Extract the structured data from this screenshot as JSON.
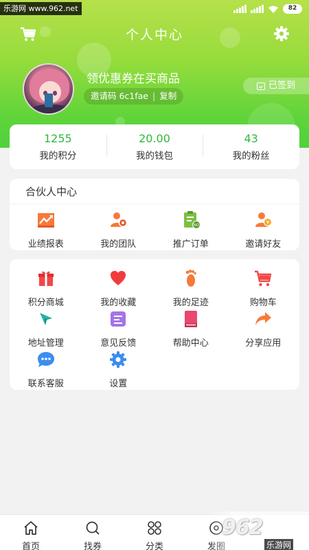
{
  "status_bar": {
    "watermark": "乐游网 www.962.net",
    "battery": "82"
  },
  "header": {
    "title": "个人中心"
  },
  "profile": {
    "username": "领优惠券在买商品",
    "invite_label": "邀请码 6c1fae",
    "copy_label": "复制",
    "signin_label": "已签到"
  },
  "stats": [
    {
      "value": "1255",
      "label": "我的积分"
    },
    {
      "value": "20.00",
      "label": "我的钱包"
    },
    {
      "value": "43",
      "label": "我的粉丝"
    }
  ],
  "partner": {
    "title": "合伙人中心",
    "items": [
      {
        "label": "业绩报表",
        "icon": "chart-trend-icon"
      },
      {
        "label": "我的团队",
        "icon": "team-icon"
      },
      {
        "label": "推广订单",
        "icon": "order-clipboard-icon"
      },
      {
        "label": "邀请好友",
        "icon": "invite-friend-icon"
      }
    ]
  },
  "tools": {
    "items": [
      {
        "label": "积分商城",
        "icon": "gift-icon"
      },
      {
        "label": "我的收藏",
        "icon": "heart-icon"
      },
      {
        "label": "我的足迹",
        "icon": "footprint-icon"
      },
      {
        "label": "购物车",
        "icon": "shopping-cart-icon"
      },
      {
        "label": "地址管理",
        "icon": "location-compass-icon"
      },
      {
        "label": "意见反馈",
        "icon": "feedback-icon"
      },
      {
        "label": "帮助中心",
        "icon": "help-book-icon"
      },
      {
        "label": "分享应用",
        "icon": "share-arrow-icon"
      },
      {
        "label": "联系客服",
        "icon": "chat-bubble-icon"
      },
      {
        "label": "设置",
        "icon": "settings-gear-icon"
      }
    ]
  },
  "bottom_nav": [
    {
      "label": "首页",
      "icon": "home-icon"
    },
    {
      "label": "找券",
      "icon": "search-icon"
    },
    {
      "label": "分类",
      "icon": "category-icon"
    },
    {
      "label": "发圈",
      "icon": "moments-icon"
    }
  ],
  "bottom_watermark": {
    "logo": "962",
    "text": "乐游网"
  },
  "colors": {
    "accent_green": "#2fb93c",
    "header_top": "#b6e04a",
    "header_bottom": "#4fd23c"
  }
}
